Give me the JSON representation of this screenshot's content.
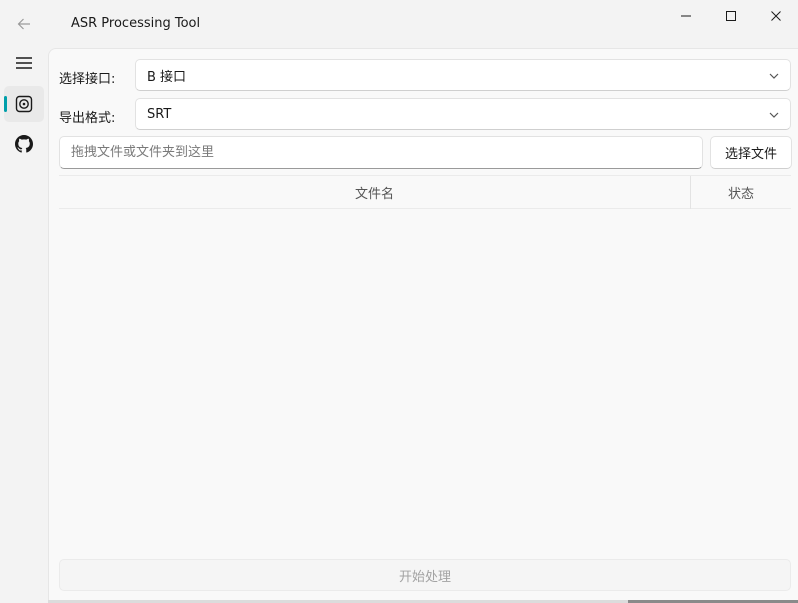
{
  "window": {
    "title": "ASR Processing Tool"
  },
  "sidebar": {
    "items": [
      {
        "icon": "menu-icon"
      },
      {
        "icon": "disc-icon",
        "selected": true
      },
      {
        "icon": "github-icon"
      }
    ],
    "accent_color": "#009faa"
  },
  "form": {
    "interface_label": "选择接口:",
    "interface_value": "B 接口",
    "format_label": "导出格式:",
    "format_value": "SRT",
    "drop_placeholder": "拖拽文件或文件夹到这里",
    "select_file_button": "选择文件"
  },
  "table": {
    "columns": [
      "文件名",
      "状态"
    ],
    "rows": []
  },
  "actions": {
    "start_button": "开始处理"
  }
}
